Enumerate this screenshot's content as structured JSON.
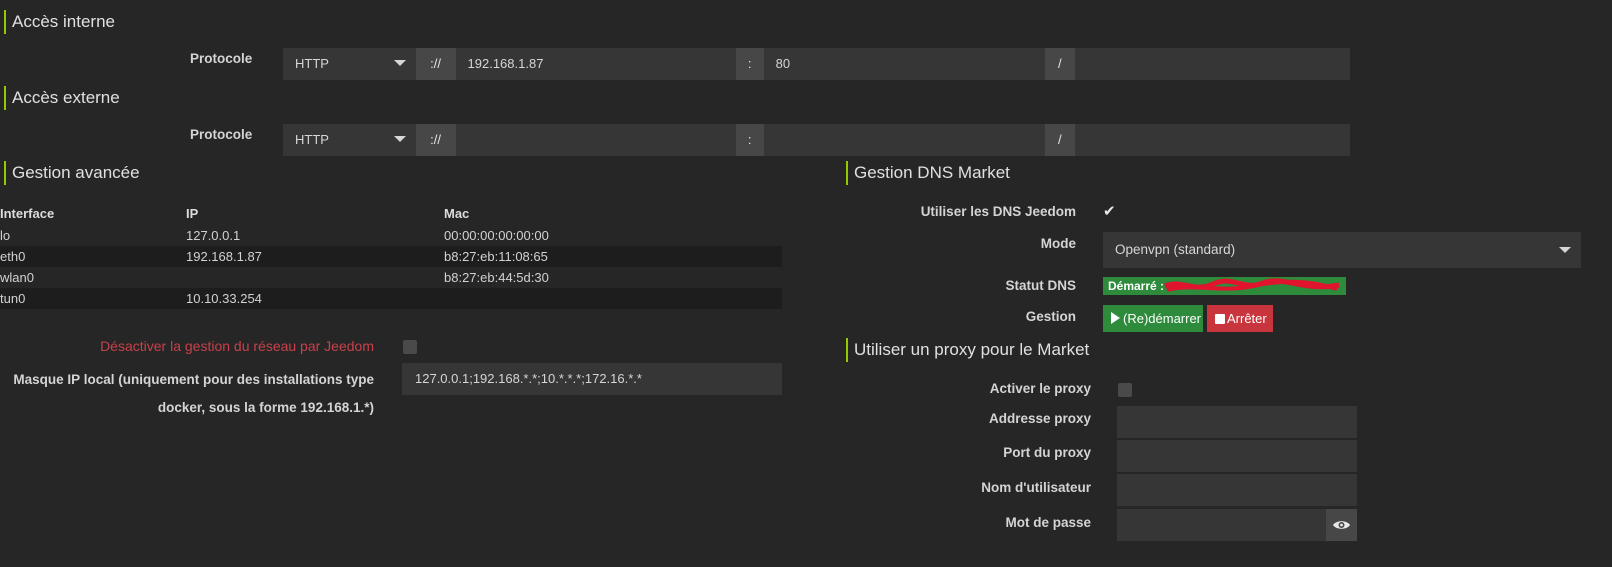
{
  "internal": {
    "title": "Accès interne",
    "protocol_label": "Protocole",
    "protocol_value": "HTTP",
    "scheme_sep": "://",
    "host": "192.168.1.87",
    "port_sep": ":",
    "port": "80",
    "path_sep": "/",
    "path": ""
  },
  "external": {
    "title": "Accès externe",
    "protocol_label": "Protocole",
    "protocol_value": "HTTP",
    "scheme_sep": "://",
    "host": "",
    "port_sep": ":",
    "port": "",
    "path_sep": "/",
    "path": ""
  },
  "advanced": {
    "title": "Gestion avancée",
    "columns": [
      "Interface",
      "IP",
      "Mac"
    ],
    "rows": [
      [
        "lo",
        "127.0.0.1",
        "00:00:00:00:00:00"
      ],
      [
        "eth0",
        "192.168.1.87",
        "b8:27:eb:11:08:65"
      ],
      [
        "wlan0",
        "",
        "b8:27:eb:44:5d:30"
      ],
      [
        "tun0",
        "10.10.33.254",
        ""
      ]
    ],
    "disable_network_label": "Désactiver la gestion du réseau par Jeedom",
    "mask_label_line1": "Masque IP local (uniquement pour des installations type",
    "mask_label_line2": "docker, sous la forme 192.168.1.*)",
    "mask_value": "127.0.0.1;192.168.*.*;10.*.*.*;172.16.*.*"
  },
  "dns": {
    "title": "Gestion DNS Market",
    "use_dns_label": "Utiliser les DNS Jeedom",
    "use_dns_checked": true,
    "mode_label": "Mode",
    "mode_value": "Openvpn (standard)",
    "status_label": "Statut DNS",
    "status_value": "Démarré :",
    "management_label": "Gestion",
    "restart_button": "(Re)démarrer",
    "stop_button": "Arrêter"
  },
  "proxy": {
    "title": "Utiliser un proxy pour le Market",
    "enable_label": "Activer le proxy",
    "address_label": "Addresse proxy",
    "port_label": "Port du proxy",
    "user_label": "Nom d'utilisateur",
    "password_label": "Mot de passe"
  },
  "colors": {
    "accent": "#94ca02",
    "success": "#2e8b3c",
    "danger": "#c8353c",
    "warning_text": "#c8414a",
    "background": "#262626"
  }
}
